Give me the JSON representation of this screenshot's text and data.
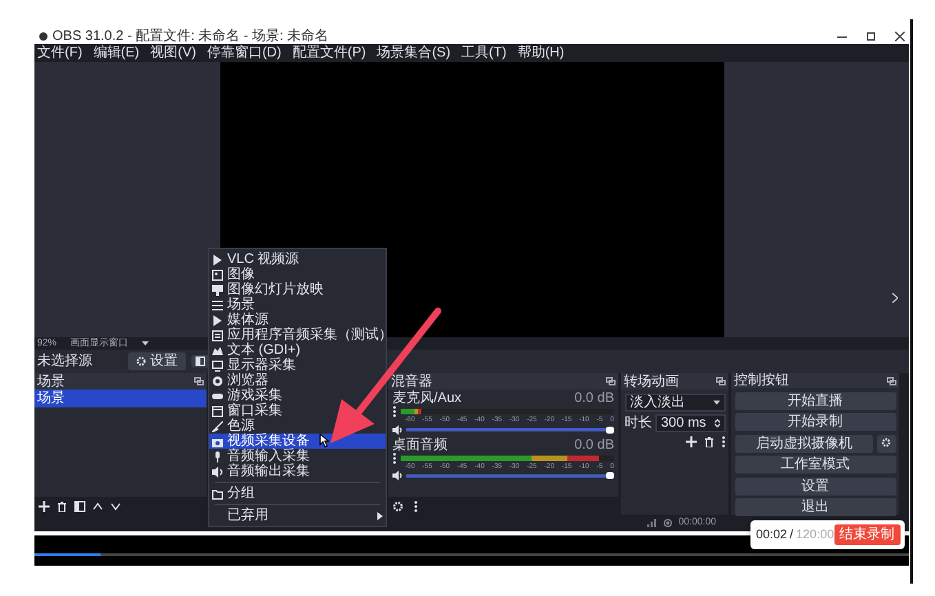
{
  "window": {
    "title": "OBS 31.0.2 - 配置文件: 未命名 - 场景: 未命名"
  },
  "menu_bar": [
    "文件(F)",
    "编辑(E)",
    "视图(V)",
    "停靠窗口(D)",
    "配置文件(P)",
    "场景集合(S)",
    "工具(T)",
    "帮助(H)"
  ],
  "preview_status": {
    "zoom": "92%",
    "mode": "画面显示窗口"
  },
  "source_toolbar": {
    "label": "未选择源",
    "button": "设置"
  },
  "scenes": {
    "title": "场景",
    "items": [
      {
        "label": "场景",
        "selected": true
      }
    ]
  },
  "context_menu": {
    "items": [
      {
        "kind": "item",
        "label": "VLC 视频源",
        "selected": false
      },
      {
        "kind": "item",
        "label": "图像",
        "selected": false
      },
      {
        "kind": "item",
        "label": "图像幻灯片放映",
        "selected": false
      },
      {
        "kind": "item",
        "label": "场景",
        "selected": false
      },
      {
        "kind": "item",
        "label": "媒体源",
        "selected": false
      },
      {
        "kind": "item",
        "label": "应用程序音频采集（测试）",
        "selected": false
      },
      {
        "kind": "item",
        "label": "文本 (GDI+)",
        "selected": false
      },
      {
        "kind": "item",
        "label": "显示器采集",
        "selected": false
      },
      {
        "kind": "item",
        "label": "浏览器",
        "selected": false
      },
      {
        "kind": "item",
        "label": "游戏采集",
        "selected": false
      },
      {
        "kind": "item",
        "label": "窗口采集",
        "selected": false
      },
      {
        "kind": "item",
        "label": "色源",
        "selected": false
      },
      {
        "kind": "item",
        "label": "视频采集设备",
        "selected": true
      },
      {
        "kind": "item",
        "label": "音频输入采集",
        "selected": false
      },
      {
        "kind": "item",
        "label": "音频输出采集",
        "selected": false
      },
      {
        "kind": "separator"
      },
      {
        "kind": "item",
        "label": "分组",
        "selected": false
      },
      {
        "kind": "separator"
      },
      {
        "kind": "submenu",
        "label": "已弃用",
        "selected": false
      }
    ]
  },
  "mixer": {
    "title": "混音器",
    "channels": [
      {
        "name": "麦克风/Aux",
        "reading": "0.0 dB",
        "level": 0.1,
        "volume": {
          "level": 1
        },
        "scale": [
          "-60",
          "-55",
          "-50",
          "-45",
          "-40",
          "-35",
          "-30",
          "-25",
          "-20",
          "-15",
          "-10",
          "-5",
          "0"
        ]
      },
      {
        "name": "桌面音频",
        "reading": "0.0 dB",
        "level": 0.93,
        "volume": {
          "level": 1
        },
        "scale": [
          "-60",
          "-55",
          "-50",
          "-45",
          "-40",
          "-35",
          "-30",
          "-25",
          "-20",
          "-15",
          "-10",
          "-5",
          "0"
        ]
      }
    ]
  },
  "transitions": {
    "title": "转场动画",
    "selected": "淡入淡出",
    "duration_label": "时长",
    "duration": "300 ms"
  },
  "controls": {
    "title": "控制按钮",
    "buttons": [
      {
        "kind": "plain",
        "label": "开始直播"
      },
      {
        "kind": "plain",
        "label": "开始录制"
      },
      {
        "kind": "with_settings",
        "label": "启动虚拟摄像机"
      },
      {
        "kind": "plain",
        "label": "工作室模式"
      },
      {
        "kind": "plain",
        "label": "设置"
      },
      {
        "kind": "plain",
        "label": "退出"
      }
    ]
  },
  "status_bar": {
    "rec_time": "00:00:00"
  },
  "recording_popup": {
    "elapsed": "00:02",
    "separator": "/",
    "total": "120:00",
    "button": "结束录制"
  },
  "player": {
    "level": 0.075
  }
}
